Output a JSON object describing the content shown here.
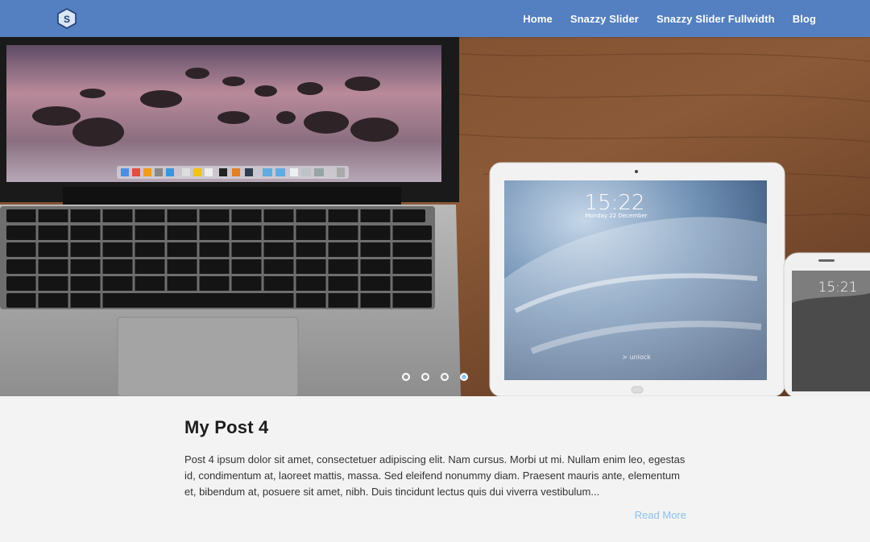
{
  "header": {
    "logo_letter": "S",
    "nav": [
      "Home",
      "Snazzy Slider",
      "Snazzy Slider Fullwidth",
      "Blog"
    ]
  },
  "slider": {
    "slide_count": 4,
    "active_index": 3,
    "tablet": {
      "time": "15:22",
      "date": "Monday 22 December",
      "unlock_hint": "> unlock"
    },
    "phone": {
      "time": "15:21"
    }
  },
  "post": {
    "title": "My Post 4",
    "excerpt": "Post 4 ipsum dolor sit amet, consectetuer adipiscing elit. Nam cursus. Morbi ut mi. Nullam enim leo, egestas id, condimentum at, laoreet mattis, massa. Sed eleifend nonummy diam. Praesent mauris ante, elementum et, bibendum at, posuere sit amet, nibh. Duis tincidunt lectus quis dui viverra vestibulum...",
    "read_more": "Read More"
  },
  "colors": {
    "header": "#547fc1",
    "accent": "#8cc0ea",
    "page_bg": "#f3f3f3"
  }
}
